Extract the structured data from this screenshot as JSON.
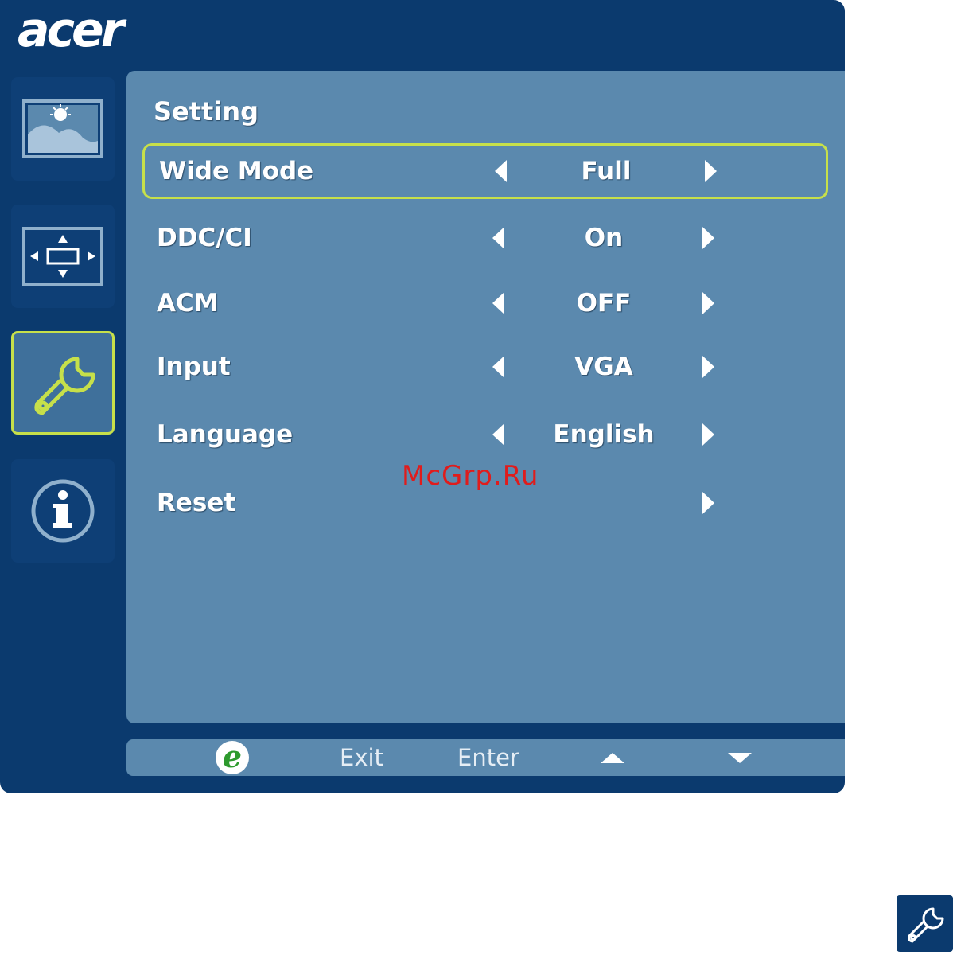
{
  "brand": {
    "logo_text": "acer",
    "colors": {
      "frame": "#0b3a6e",
      "panel": "#5b89ae",
      "highlight": "#c7e04a",
      "watermark": "#e01c1c"
    }
  },
  "sidebar": {
    "tabs": [
      {
        "icon": "picture-icon",
        "active": false
      },
      {
        "icon": "osd-position-icon",
        "active": false
      },
      {
        "icon": "wrench-icon",
        "active": true
      },
      {
        "icon": "info-icon",
        "active": false
      }
    ]
  },
  "menu": {
    "title": "Setting",
    "rows": [
      {
        "label": "Wide Mode",
        "value": "Full",
        "selected": true
      },
      {
        "label": "DDC/CI",
        "value": "On",
        "selected": false
      },
      {
        "label": "ACM",
        "value": "OFF",
        "selected": false
      },
      {
        "label": "Input",
        "value": "VGA",
        "selected": false
      },
      {
        "label": "Language",
        "value": "English",
        "selected": false
      },
      {
        "label": "Reset",
        "value": "",
        "selected": false
      }
    ]
  },
  "watermark": "McGrp.Ru",
  "footer": {
    "e_icon": "e-key-icon",
    "exit_label": "Exit",
    "enter_label": "Enter",
    "up_icon": "up-arrow-icon",
    "down_icon": "down-arrow-icon"
  },
  "corner_badge": {
    "icon": "wrench-icon"
  }
}
